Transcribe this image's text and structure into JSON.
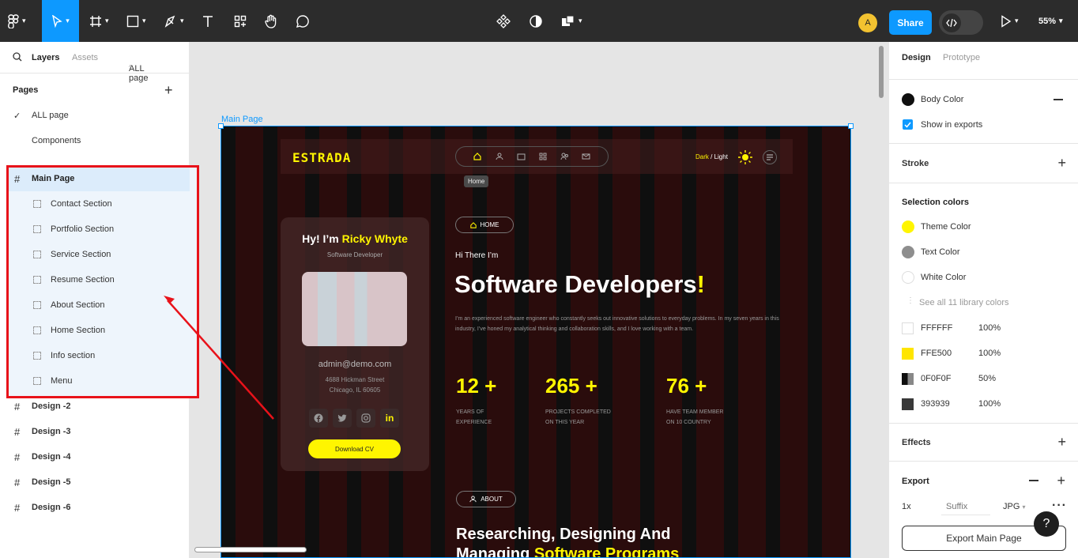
{
  "toolbar": {
    "share_label": "Share",
    "avatar_initial": "A",
    "zoom": "55%"
  },
  "layers_panel": {
    "tab_layers": "Layers",
    "tab_assets": "Assets",
    "page_selector": "ALL page",
    "pages_title": "Pages",
    "pages": [
      "ALL page",
      "Components"
    ],
    "main_frame": "Main Page",
    "sections": [
      "Contact Section",
      "Portfolio Section",
      "Service Section",
      "Resume Section",
      "About Section",
      "Home Section",
      "Info section",
      "Menu"
    ],
    "designs": [
      "Design -2",
      "Design -3",
      "Design -4",
      "Design -5",
      "Design -6"
    ]
  },
  "canvas": {
    "frame_label": "Main Page",
    "logo": "ESTRADA",
    "nav_tooltip": "Home",
    "theme_toggle_dark": "Dark",
    "theme_toggle_sep": " / ",
    "theme_toggle_light": "Light",
    "card": {
      "greeting": "Hy! I’m ",
      "name": "Ricky Whyte",
      "role": "Software Developer",
      "email": "admin@demo.com",
      "address_line1": "4688 Hickman Street",
      "address_line2": "Chicago, IL 60605",
      "cv_button": "Download CV"
    },
    "home_badge": "HOME",
    "hi": "Hi There I’m",
    "headline": "Software Developers",
    "headline_mark": "!",
    "intro": "I’m an experienced software engineer who constantly seeks out innovative solutions to everyday problems. In my seven years in this industry, I’ve honed my analytical thinking and collaboration skills, and I love working with a team.",
    "stats": [
      {
        "value": "12 +",
        "line1": "YEARS OF",
        "line2": "EXPERIENCE"
      },
      {
        "value": "265 +",
        "line1": "PROJECTS COMPLETED",
        "line2": "ON THIS YEAR"
      },
      {
        "value": "76 +",
        "line1": "HAVE TEAM MEMBER",
        "line2": "ON 10 COUNTRY"
      }
    ],
    "about_badge": "ABOUT",
    "about_heading1": "Researching, Designing And",
    "about_heading2a": "Managing ",
    "about_heading2b": "Software Programs"
  },
  "design_panel": {
    "tab_design": "Design",
    "tab_prototype": "Prototype",
    "fill_name": "Body Color",
    "show_in_exports": "Show in exports",
    "stroke_title": "Stroke",
    "selection_colors_title": "Selection colors",
    "library_colors": [
      {
        "name": "Theme Color",
        "color": "#FFF500"
      },
      {
        "name": "Text Color",
        "color": "#8E8E8E"
      },
      {
        "name": "White Color",
        "color": "#FFFFFF"
      }
    ],
    "see_all": "See all 11 library colors",
    "hex_colors": [
      {
        "hex": "FFFFFF",
        "opacity": "100%",
        "color": "#FFFFFF"
      },
      {
        "hex": "FFE500",
        "opacity": "100%",
        "color": "#FFE500"
      },
      {
        "hex": "0F0F0F",
        "opacity": "50%",
        "color": "#0F0F0F"
      },
      {
        "hex": "393939",
        "opacity": "100%",
        "color": "#393939"
      }
    ],
    "effects_title": "Effects",
    "export_title": "Export",
    "export_scale": "1x",
    "export_suffix_placeholder": "Suffix",
    "export_format": "JPG",
    "export_button": "Export Main Page"
  },
  "colors": {
    "accent": "#0D99FF",
    "theme_yellow": "#FFF500",
    "annotation_red": "#E8121A"
  }
}
